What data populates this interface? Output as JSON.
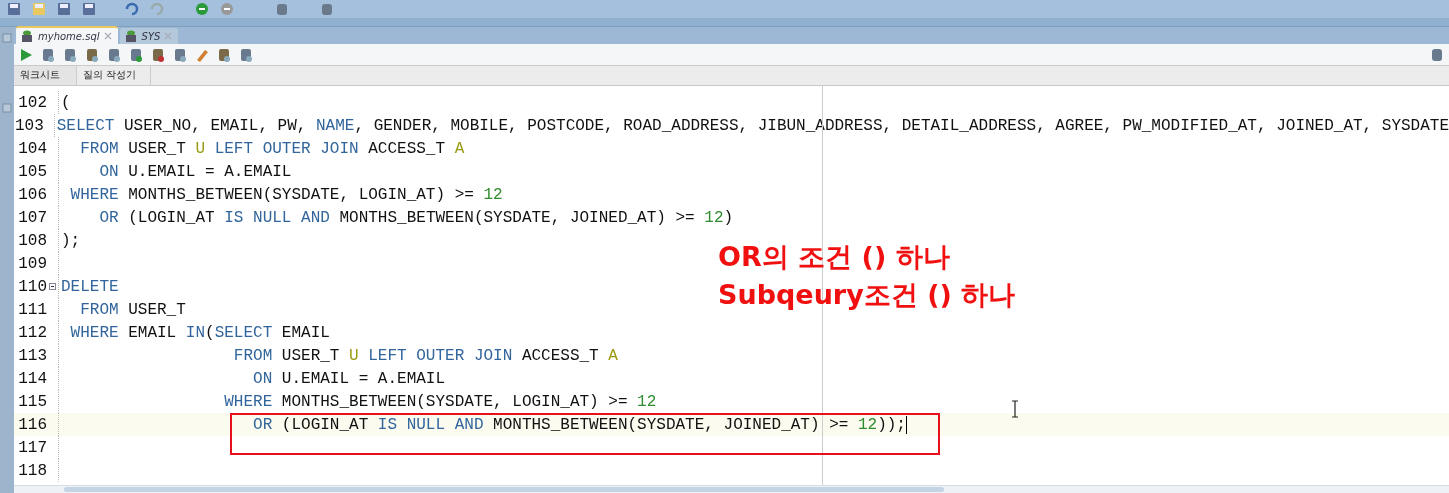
{
  "doc_tabs": [
    {
      "label": "myhome.sql",
      "selected": true
    },
    {
      "label": "SYS",
      "selected": false
    }
  ],
  "sub_tabs": [
    {
      "label": "워크시트",
      "selected": true
    },
    {
      "label": "질의 작성기",
      "selected": false
    }
  ],
  "editor": {
    "lines": [
      {
        "number": "102",
        "current": false,
        "foldable": false,
        "segments": [
          {
            "kind": "plain",
            "text": "("
          }
        ]
      },
      {
        "number": "103",
        "current": false,
        "foldable": false,
        "segments": [
          {
            "kind": "keyword",
            "text": "SELECT"
          },
          {
            "kind": "plain",
            "text": " USER_NO, EMAIL, PW, "
          },
          {
            "kind": "keyword",
            "text": "NAME"
          },
          {
            "kind": "plain",
            "text": ", GENDER, MOBILE, POSTCODE, ROAD_ADDRESS, JIBUN_ADDRESS, DETAIL_ADDRESS, AGREE, PW_MODIFIED_AT, JOINED_AT, SYSDATE"
          }
        ]
      },
      {
        "number": "104",
        "current": false,
        "foldable": false,
        "segments": [
          {
            "kind": "keyword",
            "text": "  FROM"
          },
          {
            "kind": "plain",
            "text": " USER_T "
          },
          {
            "kind": "alias",
            "text": "U"
          },
          {
            "kind": "keyword",
            "text": " LEFT OUTER JOIN"
          },
          {
            "kind": "plain",
            "text": " ACCESS_T "
          },
          {
            "kind": "alias",
            "text": "A"
          }
        ]
      },
      {
        "number": "105",
        "current": false,
        "foldable": false,
        "segments": [
          {
            "kind": "keyword",
            "text": "    ON"
          },
          {
            "kind": "plain",
            "text": " U.EMAIL = A.EMAIL"
          }
        ]
      },
      {
        "number": "106",
        "current": false,
        "foldable": false,
        "segments": [
          {
            "kind": "keyword",
            "text": " WHERE"
          },
          {
            "kind": "plain",
            "text": " MONTHS_BETWEEN(SYSDATE, LOGIN_AT) >= "
          },
          {
            "kind": "number",
            "text": "12"
          }
        ]
      },
      {
        "number": "107",
        "current": false,
        "foldable": false,
        "segments": [
          {
            "kind": "keyword",
            "text": "    OR"
          },
          {
            "kind": "plain",
            "text": " (LOGIN_AT "
          },
          {
            "kind": "keyword",
            "text": "IS NULL AND"
          },
          {
            "kind": "plain",
            "text": " MONTHS_BETWEEN(SYSDATE, JOINED_AT) >= "
          },
          {
            "kind": "number",
            "text": "12"
          },
          {
            "kind": "plain",
            "text": ")"
          }
        ]
      },
      {
        "number": "108",
        "current": false,
        "foldable": false,
        "segments": [
          {
            "kind": "plain",
            "text": ");"
          }
        ]
      },
      {
        "number": "109",
        "current": false,
        "foldable": false
      },
      {
        "number": "110",
        "current": false,
        "foldable": true,
        "segments": [
          {
            "kind": "keyword",
            "text": "DELETE"
          }
        ]
      },
      {
        "number": "111",
        "current": false,
        "foldable": false,
        "segments": [
          {
            "kind": "keyword",
            "text": "  FROM"
          },
          {
            "kind": "plain",
            "text": " USER_T"
          }
        ]
      },
      {
        "number": "112",
        "current": false,
        "foldable": false,
        "segments": [
          {
            "kind": "keyword",
            "text": " WHERE"
          },
          {
            "kind": "plain",
            "text": " EMAIL "
          },
          {
            "kind": "keyword",
            "text": "IN"
          },
          {
            "kind": "plain",
            "text": "("
          },
          {
            "kind": "keyword",
            "text": "SELECT"
          },
          {
            "kind": "plain",
            "text": " EMAIL"
          }
        ]
      },
      {
        "number": "113",
        "current": false,
        "foldable": false,
        "segments": [
          {
            "kind": "keyword",
            "text": "                  FROM"
          },
          {
            "kind": "plain",
            "text": " USER_T "
          },
          {
            "kind": "alias",
            "text": "U"
          },
          {
            "kind": "keyword",
            "text": " LEFT OUTER JOIN"
          },
          {
            "kind": "plain",
            "text": " ACCESS_T "
          },
          {
            "kind": "alias",
            "text": "A"
          }
        ]
      },
      {
        "number": "114",
        "current": false,
        "foldable": false,
        "segments": [
          {
            "kind": "keyword",
            "text": "                    ON"
          },
          {
            "kind": "plain",
            "text": " U.EMAIL = A.EMAIL"
          }
        ]
      },
      {
        "number": "115",
        "current": false,
        "foldable": false,
        "segments": [
          {
            "kind": "keyword",
            "text": "                 WHERE"
          },
          {
            "kind": "plain",
            "text": " MONTHS_BETWEEN(SYSDATE, LOGIN_AT) >= "
          },
          {
            "kind": "number",
            "text": "12"
          }
        ]
      },
      {
        "number": "116",
        "current": true,
        "foldable": false,
        "segments": [
          {
            "kind": "keyword",
            "text": "                    OR"
          },
          {
            "kind": "plain",
            "text": " (LOGIN_AT "
          },
          {
            "kind": "keyword",
            "text": "IS NULL AND"
          },
          {
            "kind": "plain",
            "text": " MONTHS_BETWEEN(SYSDATE, JOINED_AT) >= "
          },
          {
            "kind": "number",
            "text": "12"
          },
          {
            "kind": "plain",
            "text": "));"
          }
        ]
      },
      {
        "number": "117",
        "current": false,
        "foldable": false
      },
      {
        "number": "118",
        "current": false,
        "foldable": false
      }
    ]
  },
  "annotation": {
    "lines": [
      "OR의 조건 () 하나",
      "Subqeury조건 () 하나"
    ]
  }
}
